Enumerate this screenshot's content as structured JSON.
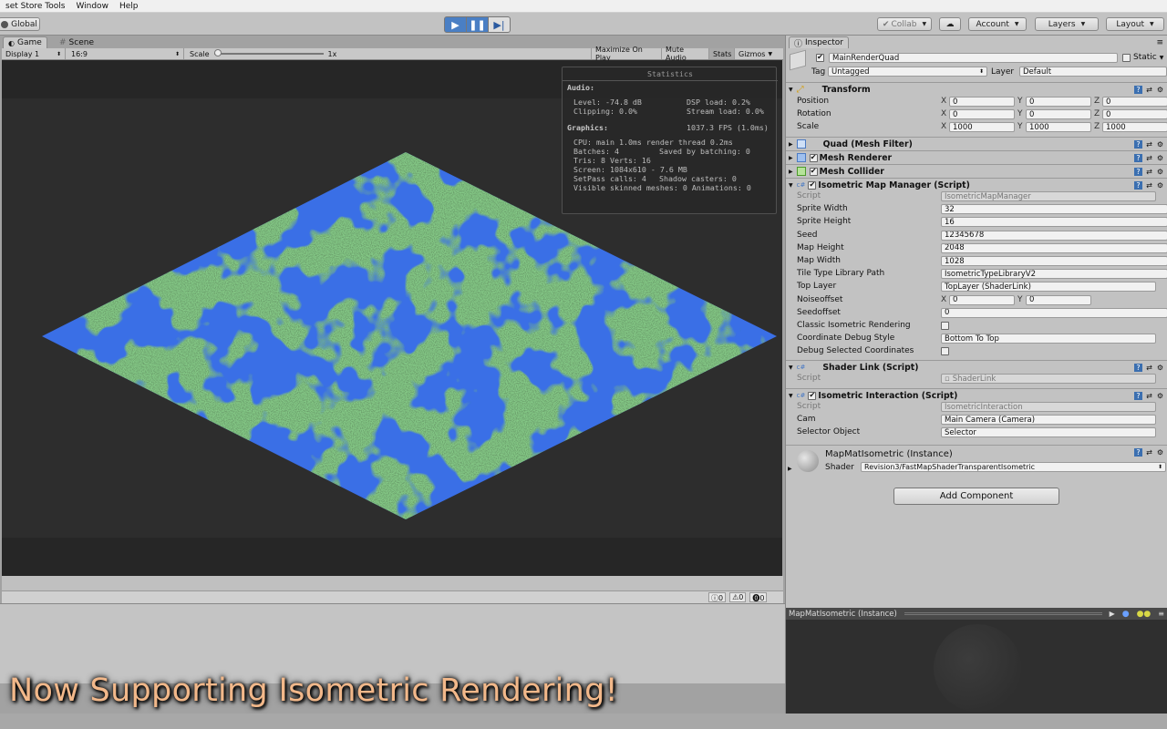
{
  "menu": [
    "set Store Tools",
    "Window",
    "Help"
  ],
  "toolbar": {
    "global": "Global",
    "collab": "Collab",
    "account": "Account",
    "layers": "Layers",
    "layout": "Layout"
  },
  "game": {
    "tab_game": "Game",
    "tab_scene": "Scene",
    "display": "Display 1",
    "aspect": "16:9",
    "scale_label": "Scale",
    "scale_value": "1x",
    "maximize": "Maximize On Play",
    "mute": "Mute Audio",
    "stats": "Stats",
    "gizmos": "Gizmos"
  },
  "stats": {
    "title": "Statistics",
    "audio_h": "Audio:",
    "level": "Level: -74.8 dB",
    "dsp": "DSP load: 0.2%",
    "clipping": "Clipping: 0.0%",
    "stream": "Stream load: 0.0%",
    "graphics_h": "Graphics:",
    "fps": "1037.3 FPS (1.0ms)",
    "cpu": "CPU: main 1.0ms  render thread 0.2ms",
    "batches": "Batches: 4",
    "saved": "Saved by batching: 0",
    "tris": "Tris: 8    Verts: 16",
    "screen": "Screen: 1084x610 - 7.6 MB",
    "setpass": "SetPass calls: 4",
    "shadow": "Shadow casters: 0",
    "skinned": "Visible skinned meshes: 0  Animations: 0"
  },
  "console": {
    "count_info": "0",
    "count_warn": "0",
    "count_err": "0"
  },
  "banner": "Now Supporting Isometric Rendering!",
  "inspector": {
    "tab": "Inspector",
    "object_name": "MainRenderQuad",
    "static_label": "Static",
    "tag_label": "Tag",
    "tag_value": "Untagged",
    "layer_label": "Layer",
    "layer_value": "Default",
    "transform": {
      "title": "Transform",
      "position_label": "Position",
      "rotation_label": "Rotation",
      "scale_label": "Scale",
      "axis_x": "X",
      "axis_y": "Y",
      "axis_z": "Z",
      "position": [
        "0",
        "0",
        "0"
      ],
      "rotation": [
        "0",
        "0",
        "0"
      ],
      "scale": [
        "1000",
        "1000",
        "1000"
      ]
    },
    "components": {
      "mesh_filter": "Quad (Mesh Filter)",
      "mesh_renderer": "Mesh Renderer",
      "mesh_collider": "Mesh Collider",
      "map_manager": "Isometric Map Manager (Script)",
      "shader_link": "Shader Link (Script)",
      "interaction": "Isometric Interaction (Script)"
    },
    "map_manager_fields": [
      {
        "label": "Script",
        "value": "IsometricMapManager"
      },
      {
        "label": "Sprite Width",
        "value": "32"
      },
      {
        "label": "Sprite Height",
        "value": "16"
      },
      {
        "label": "Seed",
        "value": "12345678"
      },
      {
        "label": "Map Height",
        "value": "2048"
      },
      {
        "label": "Map Width",
        "value": "1028"
      },
      {
        "label": "Tile Type Library Path",
        "value": "IsometricTypeLibraryV2"
      },
      {
        "label": "Top Layer",
        "value": "TopLayer (ShaderLink)"
      },
      {
        "label": "Noiseoffset",
        "value": "0"
      },
      {
        "label": "Seedoffset",
        "value": "0"
      },
      {
        "label": "Classic Isometric Rendering",
        "value": "✔"
      },
      {
        "label": "Coordinate Debug Style",
        "value": "Bottom To Top"
      },
      {
        "label": "Debug Selected Coordinates",
        "value": "✔"
      }
    ],
    "noise_y": "0",
    "shader_script_label": "Script",
    "shader_script": "ShaderLink",
    "interaction_fields": [
      {
        "label": "Script",
        "value": "IsometricInteraction"
      },
      {
        "label": "Cam",
        "value": "Main Camera (Camera)"
      },
      {
        "label": "Selector Object",
        "value": "Selector"
      }
    ],
    "material_name": "MapMatIsometric (Instance)",
    "shader_label": "Shader",
    "shader_value": "Revision3/FastMapShaderTransparentIsometric",
    "add_component": "Add Component",
    "preview_title": "MapMatIsometric (Instance)"
  },
  "colors": {
    "water": "#3a6fe6",
    "land": "#3aa74a"
  }
}
